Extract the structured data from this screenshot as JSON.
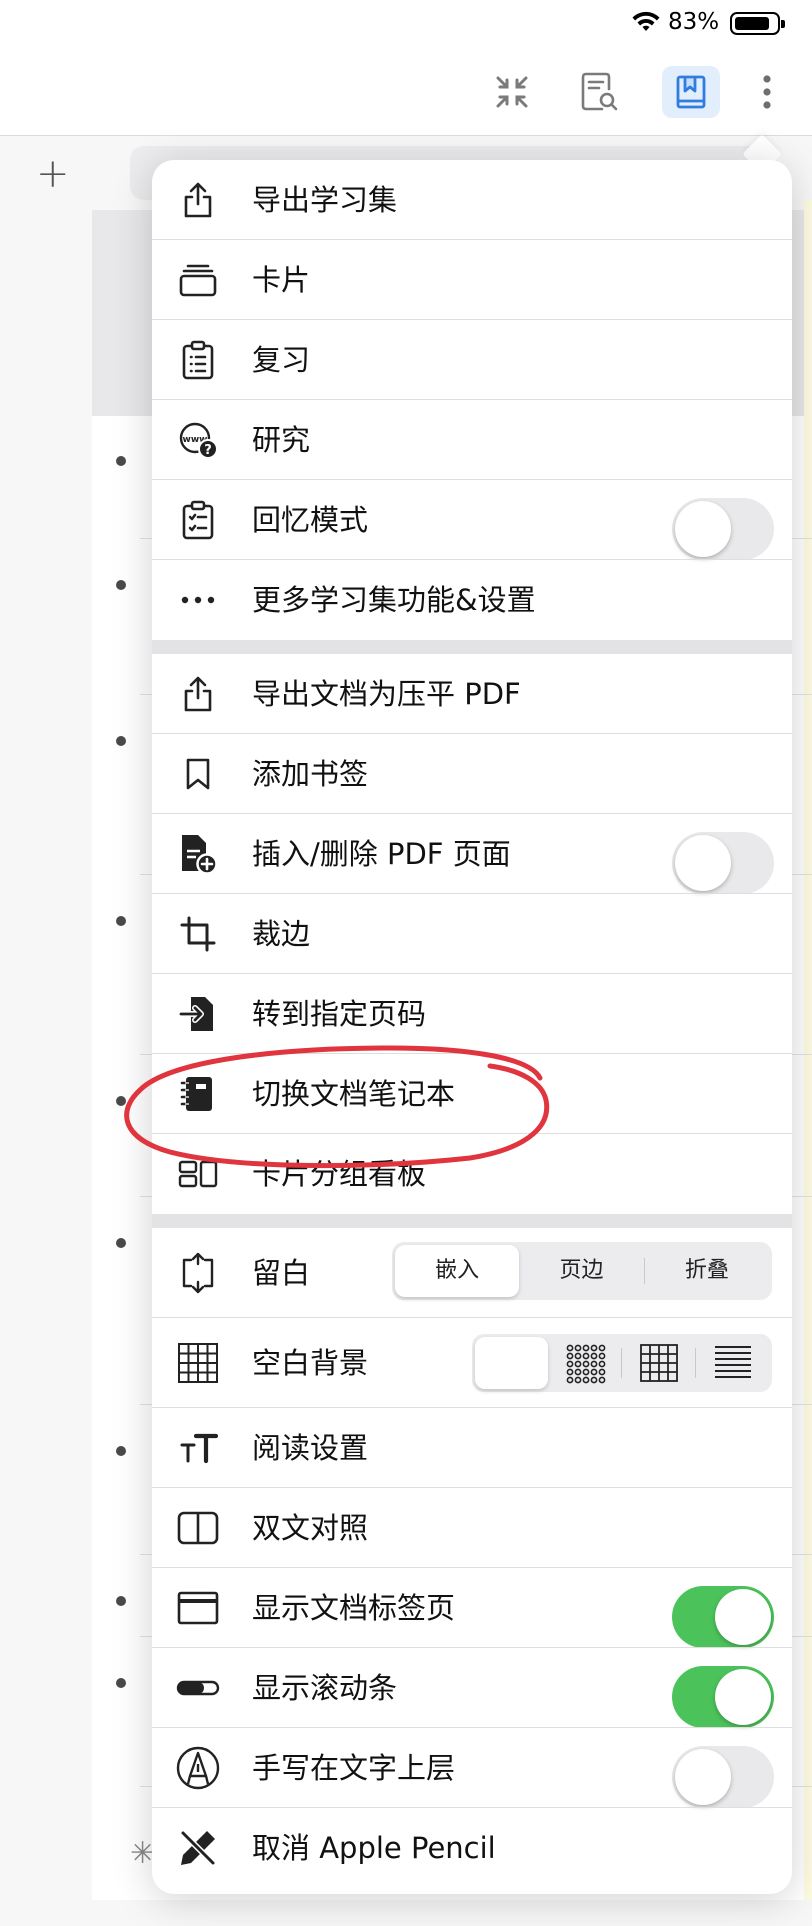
{
  "status_bar": {
    "battery_percent": "83%",
    "battery_level": 0.83,
    "icons": [
      "wifi-icon",
      "battery-icon"
    ]
  },
  "toolbar": {
    "buttons": [
      "collapse-icon",
      "document-search-icon",
      "bookmark-book-icon",
      "more-vertical-icon"
    ],
    "active": "bookmark-book-icon",
    "accent": "#2f7de1"
  },
  "menu": {
    "study_set": [
      {
        "label": "导出学习集",
        "icon": "share-export-icon"
      },
      {
        "label": "卡片",
        "icon": "cards-icon"
      },
      {
        "label": "复习",
        "icon": "clipboard-list-icon"
      },
      {
        "label": "研究",
        "icon": "web-question-icon"
      },
      {
        "label": "回忆模式",
        "icon": "clipboard-check-icon",
        "toggle": false
      },
      {
        "label": "更多学习集功能&设置",
        "icon": "ellipsis-icon"
      }
    ],
    "document": [
      {
        "label": "导出文档为压平 PDF",
        "icon": "share-export-icon"
      },
      {
        "label": "添加书签",
        "icon": "bookmark-icon"
      },
      {
        "label": "插入/删除 PDF 页面",
        "icon": "file-plus-icon",
        "toggle": false
      },
      {
        "label": "裁边",
        "icon": "crop-icon"
      },
      {
        "label": "转到指定页码",
        "icon": "go-to-page-icon"
      },
      {
        "label": "切换文档笔记本",
        "icon": "notebook-icon"
      },
      {
        "label": "卡片分组看板",
        "icon": "kanban-icon"
      }
    ],
    "margin": {
      "label": "留白",
      "icon": "margin-expand-icon",
      "options": [
        "嵌入",
        "页边",
        "折叠"
      ],
      "selected": "嵌入"
    },
    "background": {
      "label": "空白背景",
      "icon": "grid-icon",
      "options": [
        "blank",
        "dots",
        "grid",
        "lines"
      ],
      "selected": "blank"
    },
    "settings": [
      {
        "label": "阅读设置",
        "icon": "text-size-icon"
      },
      {
        "label": "双文对照",
        "icon": "split-view-icon"
      },
      {
        "label": "显示文档标签页",
        "icon": "browser-tabs-icon",
        "toggle": true
      },
      {
        "label": "显示滚动条",
        "icon": "scrollbar-icon",
        "toggle": true
      },
      {
        "label": "手写在文字上层",
        "icon": "pen-nib-icon",
        "toggle": false
      },
      {
        "label": "取消 Apple Pencil",
        "icon": "pencil-cancel-icon"
      }
    ]
  },
  "colors": {
    "toggle_on": "#4cc35a",
    "annotation": "#e0353f"
  }
}
